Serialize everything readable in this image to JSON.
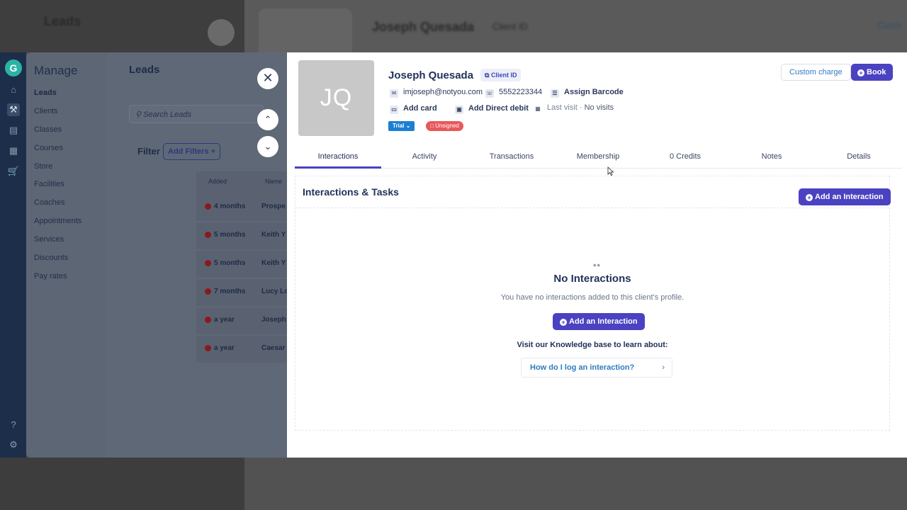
{
  "background": {
    "title": "Leads",
    "client_name": "Joseph Quesada",
    "client_id": "Client ID",
    "right_link": "Custo"
  },
  "sidebar_icons": [
    "home-icon",
    "wrench-icon",
    "contact-icon",
    "chart-icon",
    "cart-icon",
    "help-icon",
    "settings-icon"
  ],
  "manage": {
    "title": "Manage",
    "items": [
      {
        "label": "Leads",
        "active": true
      },
      {
        "label": "Clients"
      },
      {
        "label": "Classes"
      },
      {
        "label": "Courses"
      },
      {
        "label": "Store"
      },
      {
        "label": "Facilities"
      },
      {
        "label": "Coaches"
      },
      {
        "label": "Appointments"
      },
      {
        "label": "Services"
      },
      {
        "label": "Discounts"
      },
      {
        "label": "Pay rates"
      }
    ]
  },
  "leads": {
    "title": "Leads",
    "search_placeholder": "Search Leads",
    "filter_label": "Filter",
    "add_filters": "Add Filters",
    "columns": [
      "Added",
      "Name"
    ],
    "rows": [
      {
        "added": "4 months",
        "name": "Prospe"
      },
      {
        "added": "5 months",
        "name": "Keith Y"
      },
      {
        "added": "5 months",
        "name": "Keith Y"
      },
      {
        "added": "7 months",
        "name": "Lucy Lo"
      },
      {
        "added": "a year",
        "name": "Joseph"
      },
      {
        "added": "a year",
        "name": "Caesar"
      }
    ]
  },
  "client": {
    "initials": "JQ",
    "name": "Joseph Quesada",
    "client_id_label": "Client ID",
    "email": "imjoseph@notyou.com",
    "phone": "5552223344",
    "assign_barcode": "Assign Barcode",
    "add_card": "Add card",
    "add_direct_debit": "Add Direct debit",
    "last_visit_label": "Last visit ·",
    "last_visit_value": "No visits",
    "status_badge": "Trial",
    "waiver_badge": "Unsigned",
    "custom_charge": "Custom charge",
    "book": "Book"
  },
  "tabs": [
    {
      "label": "Interactions",
      "active": true
    },
    {
      "label": "Activity"
    },
    {
      "label": "Transactions"
    },
    {
      "label": "Membership"
    },
    {
      "label": "0 Credits"
    },
    {
      "label": "Notes"
    },
    {
      "label": "Details"
    }
  ],
  "interactions": {
    "title": "Interactions & Tasks",
    "add_button": "Add an Interaction",
    "empty_title": "No Interactions",
    "empty_subtitle": "You have no interactions added to this client's profile.",
    "empty_add_button": "Add an Interaction",
    "kb_label": "Visit our Knowledge base to learn about:",
    "kb_link": "How do I log an interaction?"
  },
  "colors": {
    "accent": "#4a42c1",
    "link": "#2f7ac2",
    "sidebar": "#1d2e4a",
    "trial": "#1d7fd1",
    "unsigned": "#e8585a"
  }
}
